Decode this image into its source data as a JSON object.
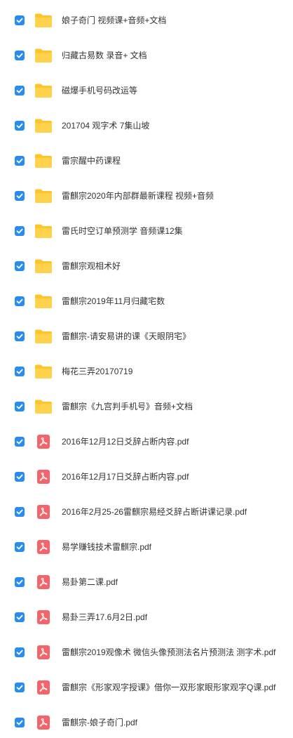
{
  "colors": {
    "checkbox": "#2a8cf0",
    "folder": "#ffc528",
    "pdf": "#f4646a",
    "text": "#333333"
  },
  "items": [
    {
      "name": "娘子奇门 视频课+音频+文档",
      "type": "folder",
      "icon": "folder-icon",
      "checked": true
    },
    {
      "name": "归藏古易数 录音+ 文档",
      "type": "folder",
      "icon": "folder-icon",
      "checked": true
    },
    {
      "name": "磁爆手机号码改运等",
      "type": "folder",
      "icon": "folder-icon",
      "checked": true
    },
    {
      "name": "201704 观字术 7集山坡",
      "type": "folder",
      "icon": "folder-icon",
      "checked": true
    },
    {
      "name": "雷宗醒中药课程",
      "type": "folder",
      "icon": "folder-icon",
      "checked": true
    },
    {
      "name": "雷麒宗2020年内部群最新课程 视频+音频",
      "type": "folder",
      "icon": "folder-icon",
      "checked": true
    },
    {
      "name": "雷氏时空订单预测学 音频课12集",
      "type": "folder",
      "icon": "folder-icon",
      "checked": true
    },
    {
      "name": "雷麒宗观相术好",
      "type": "folder",
      "icon": "folder-icon",
      "checked": true
    },
    {
      "name": "雷麒宗2019年11月归藏宅数",
      "type": "folder",
      "icon": "folder-icon",
      "checked": true
    },
    {
      "name": "雷麒宗-请安易讲的课《天眼阴宅》",
      "type": "folder",
      "icon": "folder-icon",
      "checked": true
    },
    {
      "name": "梅花三弄20170719",
      "type": "folder",
      "icon": "folder-icon",
      "checked": true
    },
    {
      "name": "雷麒宗《九宫判手机号》音频+文档",
      "type": "folder",
      "icon": "folder-icon",
      "checked": true
    },
    {
      "name": "2016年12月12日爻辞占断内容.pdf",
      "type": "pdf",
      "icon": "pdf-icon",
      "checked": true
    },
    {
      "name": "2016年12月17日爻辞占断内容.pdf",
      "type": "pdf",
      "icon": "pdf-icon",
      "checked": true
    },
    {
      "name": "2016年2月25-26雷麒宗易经爻辞占断讲课记录.pdf",
      "type": "pdf",
      "icon": "pdf-icon",
      "checked": true
    },
    {
      "name": "易学赚钱技术雷麒宗.pdf",
      "type": "pdf",
      "icon": "pdf-icon",
      "checked": true
    },
    {
      "name": "易卦第二课.pdf",
      "type": "pdf",
      "icon": "pdf-icon",
      "checked": true
    },
    {
      "name": "易卦三弄17.6月2日.pdf",
      "type": "pdf",
      "icon": "pdf-icon",
      "checked": true
    },
    {
      "name": "雷麒宗2019观像术 微信头像预测法名片预测法 测字术.pdf",
      "type": "pdf",
      "icon": "pdf-icon",
      "checked": true
    },
    {
      "name": "雷麒宗《形家观字授课》借你一双形家眼形家观字Q课.pdf",
      "type": "pdf",
      "icon": "pdf-icon",
      "checked": true
    },
    {
      "name": "雷麒宗-娘子奇门.pdf",
      "type": "pdf",
      "icon": "pdf-icon",
      "checked": true
    }
  ]
}
